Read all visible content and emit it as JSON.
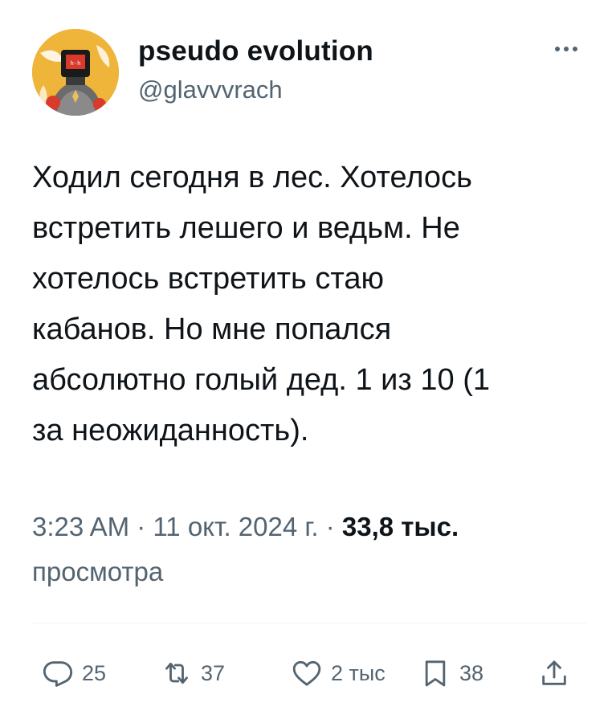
{
  "author": {
    "display_name": "pseudo evolution",
    "handle": "@glavvvrach"
  },
  "tweet": {
    "text": "Ходил сегодня в лес. Хотелось\nвстретить лешего и ведьм. Не\nхотелось встретить стаю\nкабанов. Но мне попался\nабсолютно голый дед. 1 из 10 (1\nза неожиданность)."
  },
  "meta": {
    "time": "3:23 AM",
    "sep1": " · ",
    "date": "11 окт. 2024 г.",
    "sep2": " · ",
    "views_count": "33,8 тыс.",
    "views_label": "просмотра"
  },
  "actions": {
    "reply_count": "25",
    "retweet_count": "37",
    "like_count": "2 тыс",
    "bookmark_count": "38"
  },
  "colors": {
    "text": "#0f1419",
    "secondary": "#536471",
    "divider": "#eff3f4",
    "avatar_bg": "#f0b93a"
  }
}
